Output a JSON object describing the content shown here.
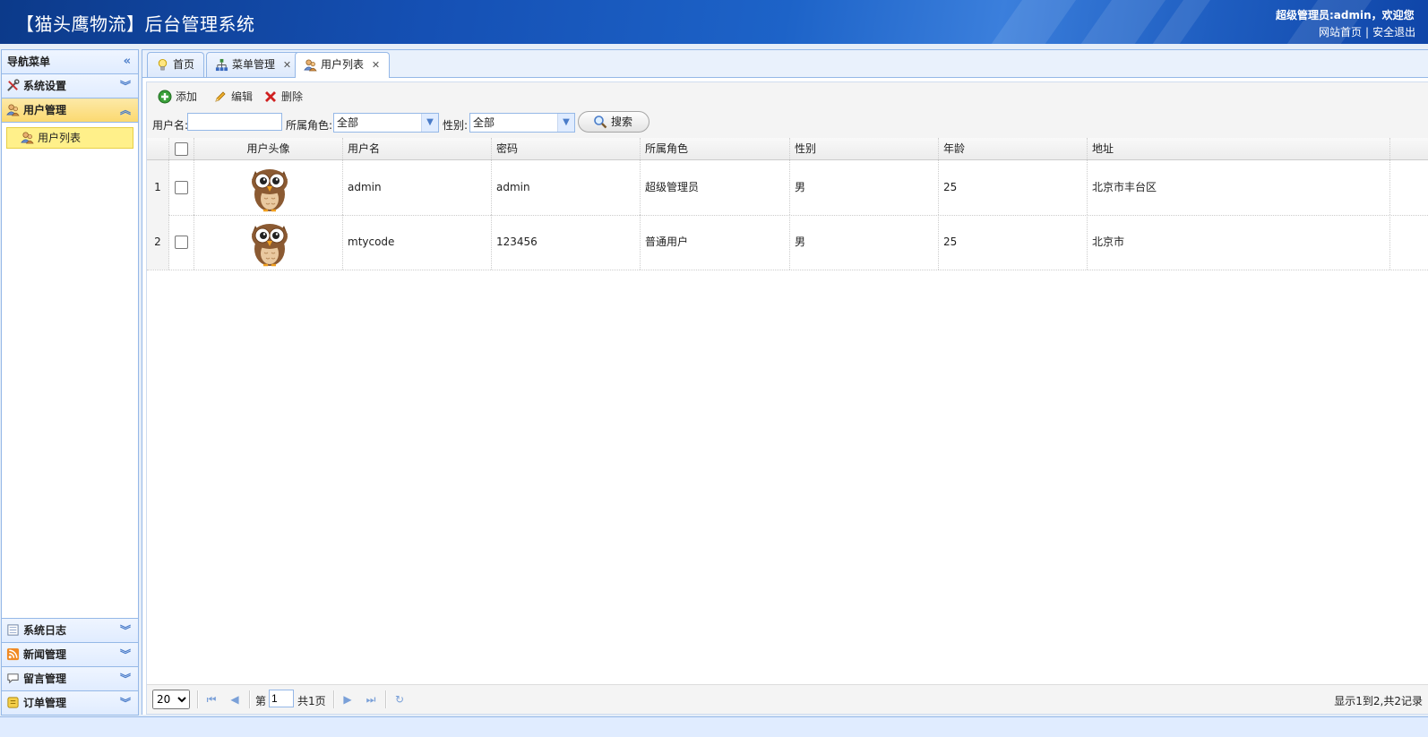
{
  "header": {
    "title": "【猫头鹰物流】后台管理系统",
    "user_text": "超级管理员:admin，欢迎您",
    "links": [
      "网站首页",
      "安全退出"
    ],
    "link_separator": "|"
  },
  "sidebar": {
    "title": "导航菜单",
    "sections_top": [
      {
        "label": "系统设置",
        "icon": "tools-icon",
        "active": false
      },
      {
        "label": "用户管理",
        "icon": "users-icon",
        "active": true
      }
    ],
    "active_items": [
      {
        "label": "用户列表",
        "icon": "users-icon"
      }
    ],
    "sections_bottom": [
      {
        "label": "系统日志",
        "icon": "log-icon"
      },
      {
        "label": "新闻管理",
        "icon": "rss-icon"
      },
      {
        "label": "留言管理",
        "icon": "comment-icon"
      },
      {
        "label": "订单管理",
        "icon": "order-icon"
      }
    ]
  },
  "tabs": [
    {
      "label": "首页",
      "icon": "lightbulb-icon",
      "closable": false
    },
    {
      "label": "菜单管理",
      "icon": "sitemap-icon",
      "closable": true
    },
    {
      "label": "用户列表",
      "icon": "users-icon",
      "closable": true,
      "active": true
    }
  ],
  "toolbar": {
    "add": "添加",
    "edit": "编辑",
    "delete": "删除"
  },
  "search": {
    "username_label": "用户名:",
    "username_value": "",
    "role_label": "所属角色:",
    "role_value": "全部",
    "gender_label": "性别:",
    "gender_value": "全部",
    "button": "搜索"
  },
  "grid": {
    "columns": [
      "用户头像",
      "用户名",
      "密码",
      "所属角色",
      "性别",
      "年龄",
      "地址"
    ],
    "rows": [
      {
        "num": "1",
        "username": "admin",
        "password": "admin",
        "role": "超级管理员",
        "gender": "男",
        "age": "25",
        "address": "北京市丰台区"
      },
      {
        "num": "2",
        "username": "mtycode",
        "password": "123456",
        "role": "普通用户",
        "gender": "男",
        "age": "25",
        "address": "北京市"
      }
    ]
  },
  "pager": {
    "page_size": "20",
    "page_prefix": "第",
    "page_value": "1",
    "page_total": "共1页",
    "info": "显示1到2,共2记录"
  }
}
